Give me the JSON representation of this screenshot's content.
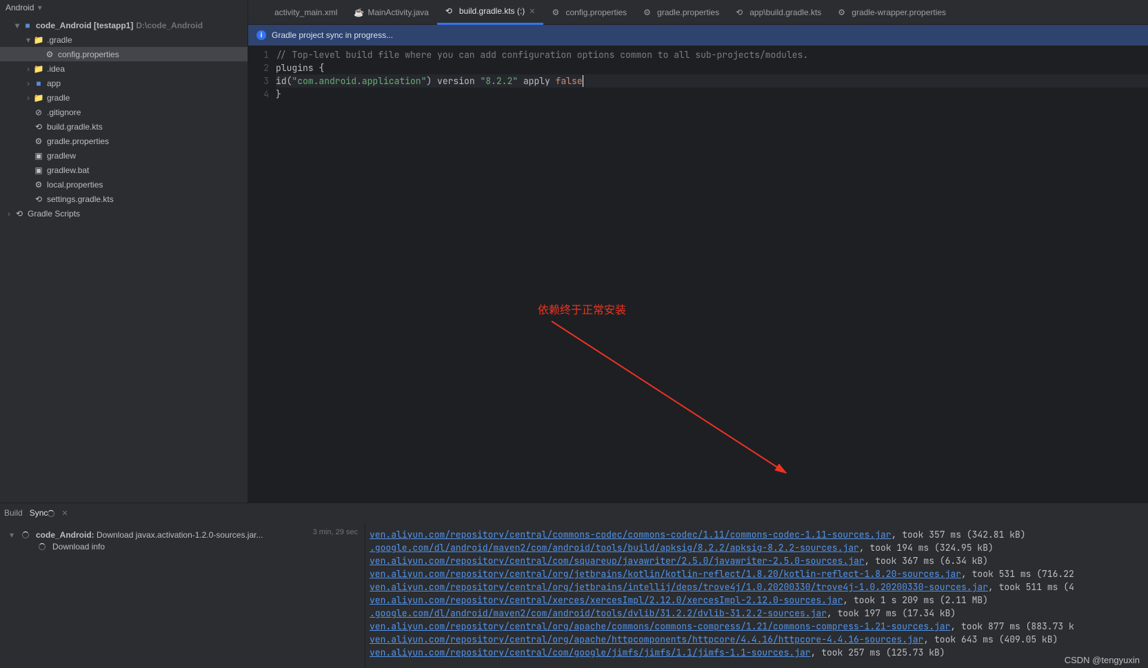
{
  "sidebar": {
    "header_label": "Android",
    "project": "code_Android",
    "project_suffix": "[testapp1]",
    "project_path": "D:\\code_Android",
    "items": [
      {
        "label": ".gradle",
        "kind": "folder",
        "open": true,
        "level": 2
      },
      {
        "label": "config.properties",
        "kind": "file-gear",
        "level": 3,
        "selected": true
      },
      {
        "label": ".idea",
        "kind": "folder",
        "level": 2,
        "collapsed": true
      },
      {
        "label": "app",
        "kind": "module",
        "level": 2,
        "collapsed": true
      },
      {
        "label": "gradle",
        "kind": "folder",
        "level": 2,
        "collapsed": true
      },
      {
        "label": ".gitignore",
        "kind": "file-ignore",
        "level": 2
      },
      {
        "label": "build.gradle.kts",
        "kind": "file-gradle",
        "level": 2
      },
      {
        "label": "gradle.properties",
        "kind": "file-gear",
        "level": 2
      },
      {
        "label": "gradlew",
        "kind": "file-sh",
        "level": 2
      },
      {
        "label": "gradlew.bat",
        "kind": "file-sh",
        "level": 2
      },
      {
        "label": "local.properties",
        "kind": "file-gear",
        "level": 2
      },
      {
        "label": "settings.gradle.kts",
        "kind": "file-gradle",
        "level": 2
      }
    ],
    "gradle_scripts": "Gradle Scripts"
  },
  "tabs": [
    {
      "label": "activity_main.xml",
      "icon": "xml"
    },
    {
      "label": "MainActivity.java",
      "icon": "java"
    },
    {
      "label": "build.gradle.kts (:)",
      "icon": "gradle",
      "active": true
    },
    {
      "label": "config.properties",
      "icon": "gear"
    },
    {
      "label": "gradle.properties",
      "icon": "gear"
    },
    {
      "label": "app\\build.gradle.kts",
      "icon": "gradle"
    },
    {
      "label": "gradle-wrapper.properties",
      "icon": "gear"
    }
  ],
  "syncbar": "Gradle project sync in progress...",
  "code": {
    "lines": [
      "1",
      "2",
      "3",
      "4"
    ],
    "l1_comment": "// Top-level build file where you can add configuration options common to all sub-projects/modules.",
    "l2_a": "plugins",
    "l2_b": " {",
    "l3_a": "    id(",
    "l3_b": "\"com.android.application\"",
    "l3_c": ") version ",
    "l3_d": "\"8.2.2\"",
    "l3_e": " apply ",
    "l3_f": "false",
    "l4": "}"
  },
  "annotation": "依赖终于正常安装",
  "bottom_tabs": {
    "build": "Build",
    "sync": "Sync"
  },
  "build": {
    "title_prefix": "code_Android:",
    "title_rest": " Download javax.activation-1.2.0-sources.jar...",
    "time": "3 min, 29 sec",
    "sub": "Download info"
  },
  "console": [
    {
      "url": "ven.aliyun.com/repository/central/commons-codec/commons-codec/1.11/commons-codec-1.11-sources.jar",
      "rest": ", took 357 ms (342.81 kB)"
    },
    {
      "url": ".google.com/dl/android/maven2/com/android/tools/build/apksig/8.2.2/apksig-8.2.2-sources.jar",
      "rest": ", took 194 ms (324.95 kB)"
    },
    {
      "url": "ven.aliyun.com/repository/central/com/squareup/javawriter/2.5.0/javawriter-2.5.0-sources.jar",
      "rest": ", took 367 ms (6.34 kB)"
    },
    {
      "url": "ven.aliyun.com/repository/central/org/jetbrains/kotlin/kotlin-reflect/1.8.20/kotlin-reflect-1.8.20-sources.jar",
      "rest": ", took 531 ms (716.22"
    },
    {
      "url": "ven.aliyun.com/repository/central/org/jetbrains/intellij/deps/trove4j/1.0.20200330/trove4j-1.0.20200330-sources.jar",
      "rest": ", took 511 ms (4"
    },
    {
      "url": "ven.aliyun.com/repository/central/xerces/xercesImpl/2.12.0/xercesImpl-2.12.0-sources.jar",
      "rest": ", took 1 s 209 ms (2.11 MB)"
    },
    {
      "url": ".google.com/dl/android/maven2/com/android/tools/dvlib/31.2.2/dvlib-31.2.2-sources.jar",
      "rest": ", took 197 ms (17.34 kB)"
    },
    {
      "url": "ven.aliyun.com/repository/central/org/apache/commons/commons-compress/1.21/commons-compress-1.21-sources.jar",
      "rest": ", took 877 ms (883.73 k"
    },
    {
      "url": "ven.aliyun.com/repository/central/org/apache/httpcomponents/httpcore/4.4.16/httpcore-4.4.16-sources.jar",
      "rest": ", took 643 ms (409.05 kB)"
    },
    {
      "url": "ven.aliyun.com/repository/central/com/google/jimfs/jimfs/1.1/jimfs-1.1-sources.jar",
      "rest": ", took 257 ms (125.73 kB)"
    }
  ],
  "watermark": "CSDN @tengyuxin"
}
